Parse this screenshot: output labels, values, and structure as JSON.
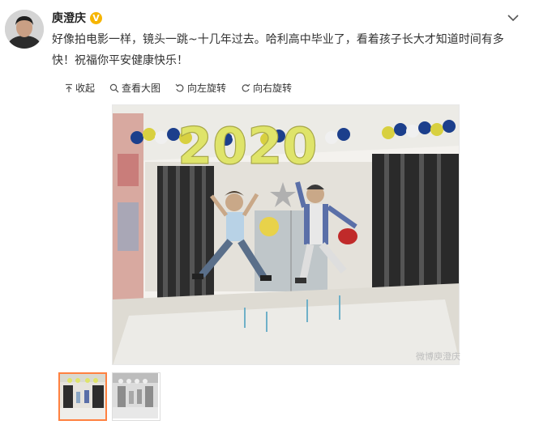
{
  "post": {
    "username": "庾澄庆",
    "verified_badge": "V",
    "text": "好像拍电影一样，镜头一跳~十几年过去。哈利高中毕业了，看着孩子长大才知道时间有多快！祝福你平安健康快乐！",
    "menu_icon": "chevron-down-icon"
  },
  "toolbar": {
    "collapse_label": "收起",
    "view_large_label": "查看大图",
    "rotate_left_label": "向左旋转",
    "rotate_right_label": "向右旋转"
  },
  "image": {
    "balloon_text": "2020",
    "watermark": "微博庾澄庆"
  },
  "thumbnails": {
    "count": 2,
    "selected_index": 0
  },
  "colors": {
    "text": "#333333",
    "badge": "#f6b500",
    "thumb_selected_border": "#ff8140"
  }
}
